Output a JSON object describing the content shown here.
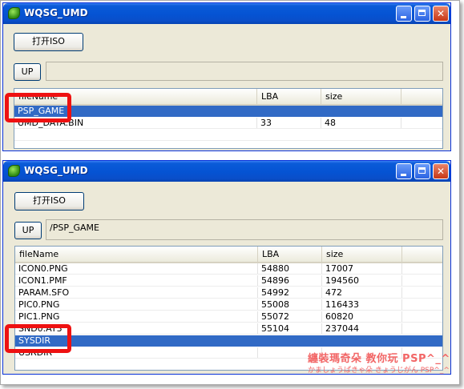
{
  "window1": {
    "title": "WQSG_UMD",
    "open_iso_button": "打开ISO",
    "up_button": "UP",
    "path": "",
    "columns": [
      "fileName",
      "LBA",
      "size"
    ],
    "rows": [
      {
        "name": "PSP_GAME",
        "lba": "",
        "size": "",
        "selected": true
      },
      {
        "name": "UMD_DATA.BIN",
        "lba": "33",
        "size": "48",
        "selected": false
      }
    ]
  },
  "window2": {
    "title": "WQSG_UMD",
    "open_iso_button": "打开ISO",
    "up_button": "UP",
    "path": "/PSP_GAME",
    "columns": [
      "fileName",
      "LBA",
      "size"
    ],
    "rows": [
      {
        "name": "ICON0.PNG",
        "lba": "54880",
        "size": "17007",
        "selected": false
      },
      {
        "name": "ICON1.PMF",
        "lba": "54896",
        "size": "194560",
        "selected": false
      },
      {
        "name": "PARAM.SFO",
        "lba": "54992",
        "size": "472",
        "selected": false
      },
      {
        "name": "PIC0.PNG",
        "lba": "55008",
        "size": "116433",
        "selected": false
      },
      {
        "name": "PIC1.PNG",
        "lba": "55072",
        "size": "60820",
        "selected": false
      },
      {
        "name": "SND0.AT3",
        "lba": "55104",
        "size": "237044",
        "selected": false
      },
      {
        "name": "SYSDIR",
        "lba": "",
        "size": "",
        "selected": true
      },
      {
        "name": "USRDIR",
        "lba": "",
        "size": "",
        "selected": false
      }
    ]
  },
  "watermark": {
    "line1": "纏裝瑪奇朵 教你玩 PSP^_^",
    "line2": "かましょうぱきゃ朵 きょうじがん PSP^_^"
  },
  "colors": {
    "titlebar": "#0553d3",
    "selection": "#316ac5",
    "callout": "#ee1111",
    "window_bg": "#ece9d8"
  },
  "icons": [
    "app-icon",
    "minimize-icon",
    "maximize-icon",
    "close-icon"
  ]
}
